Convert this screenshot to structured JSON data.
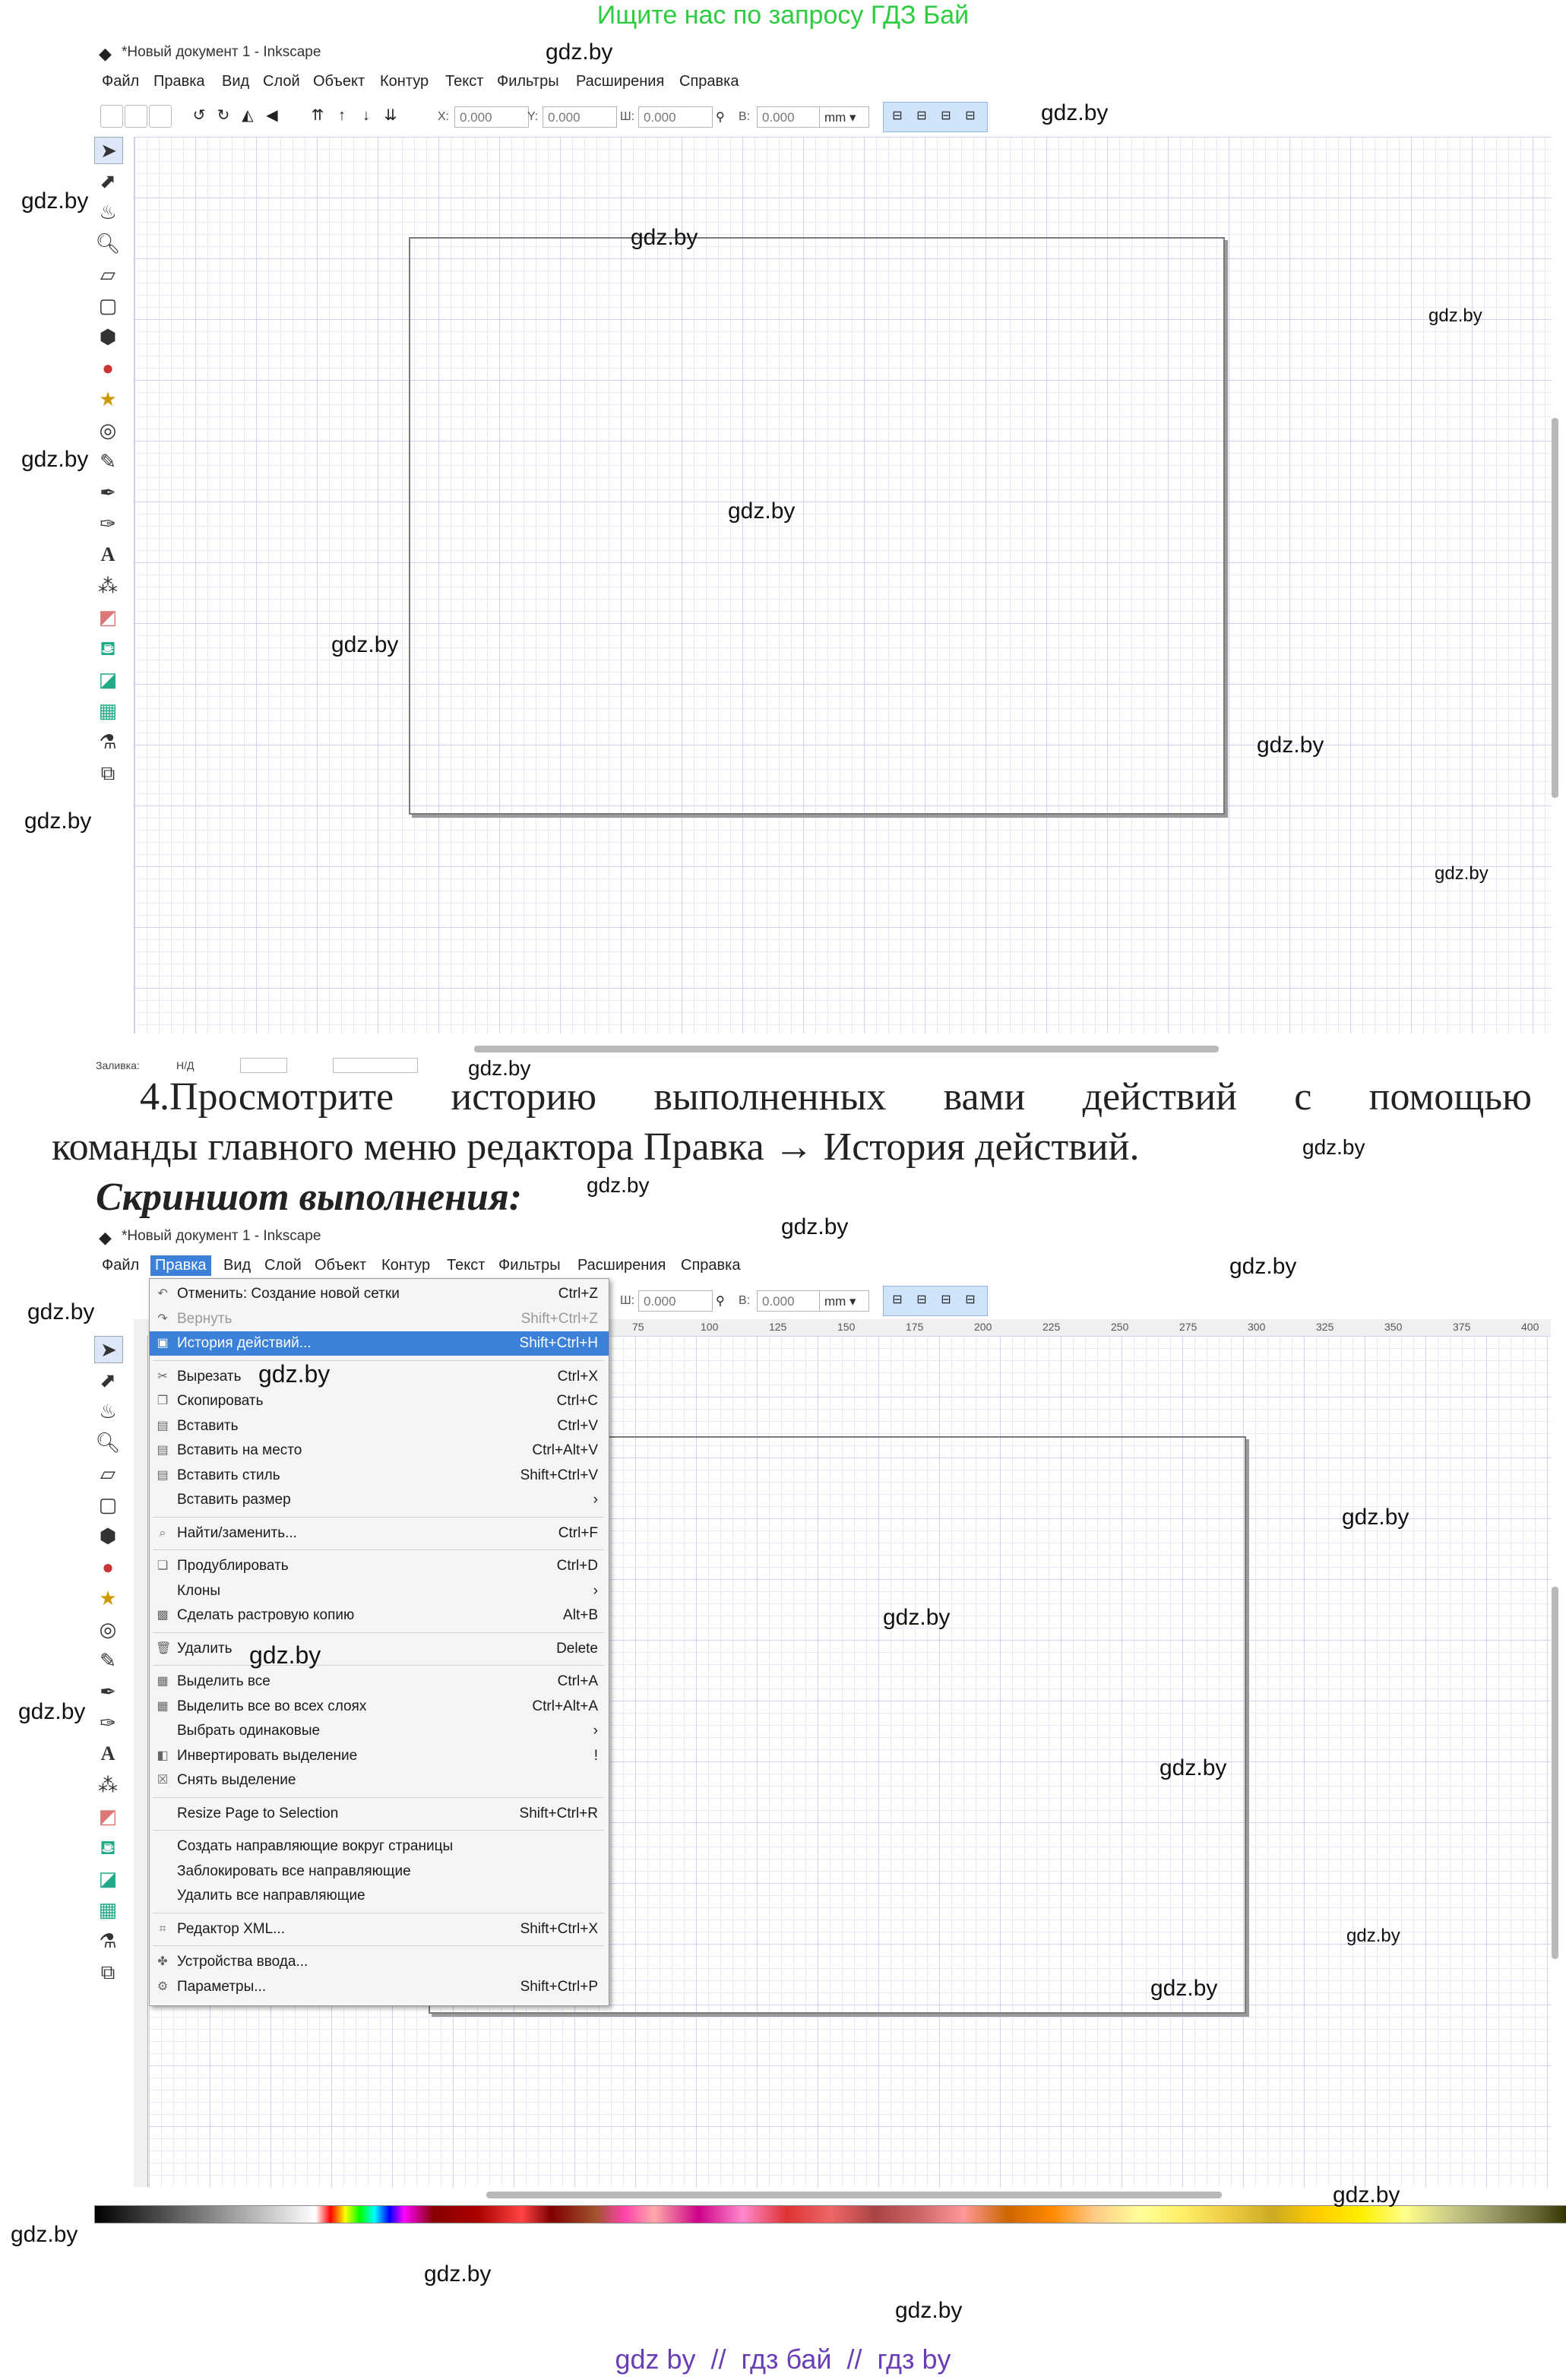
{
  "top_notice": "Ищите нас по запросу ГДЗ Бай",
  "watermark": "gdz.by",
  "window1": {
    "title": "*Новый документ 1 - Inkscape",
    "menu": [
      "Файл",
      "Правка",
      "Вид",
      "Слой",
      "Объект",
      "Контур",
      "Текст",
      "Фильтры",
      "Расширения",
      "Справка"
    ],
    "fields": {
      "x_label": "X:",
      "x_value": "0.000",
      "y_label": "Y:",
      "y_value": "0.000",
      "w_label": "Ш:",
      "w_value": "0.000",
      "h_label": "В:",
      "h_value": "0.000",
      "unit": "mm"
    },
    "status": {
      "zoom_label": "Заливка:",
      "zoom_value": "Н/Д"
    }
  },
  "task": {
    "number": "4.",
    "line1": "Просмотрите историю выполненных вами действий с помощью",
    "line2": "команды главного меню редактора Правка → История действий.",
    "caption": "Скриншот выполнения:"
  },
  "window2": {
    "title": "*Новый документ 1 - Inkscape",
    "menu": [
      "Файл",
      "Правка",
      "Вид",
      "Слой",
      "Объект",
      "Контур",
      "Текст",
      "Фильтры",
      "Расширения",
      "Справка"
    ],
    "active_menu": "Правка",
    "fields": {
      "w_label": "Ш:",
      "w_value": "0.000",
      "h_label": "В:",
      "h_value": "0.000",
      "unit": "mm"
    },
    "ruler": [
      "75",
      "100",
      "125",
      "150",
      "175",
      "200",
      "225",
      "250",
      "275",
      "300",
      "325",
      "350",
      "375",
      "400"
    ],
    "edit_menu": [
      {
        "label": "Отменить: Создание новой сетки",
        "shortcut": "Ctrl+Z",
        "icon": "undo-icon",
        "state": "normal"
      },
      {
        "label": "Вернуть",
        "shortcut": "Shift+Ctrl+Z",
        "icon": "redo-icon",
        "state": "disabled"
      },
      {
        "label": "История действий...",
        "shortcut": "Shift+Ctrl+H",
        "icon": "history-icon",
        "state": "highlighted"
      },
      {
        "sep": true
      },
      {
        "label": "Вырезать",
        "shortcut": "Ctrl+X",
        "icon": "cut-icon",
        "state": "normal"
      },
      {
        "label": "Скопировать",
        "shortcut": "Ctrl+C",
        "icon": "copy-icon",
        "state": "normal"
      },
      {
        "label": "Вставить",
        "shortcut": "Ctrl+V",
        "icon": "paste-icon",
        "state": "normal"
      },
      {
        "label": "Вставить на место",
        "shortcut": "Ctrl+Alt+V",
        "icon": "paste-in-place-icon",
        "state": "normal"
      },
      {
        "label": "Вставить стиль",
        "shortcut": "Shift+Ctrl+V",
        "icon": "paste-style-icon",
        "state": "normal"
      },
      {
        "label": "Вставить размер",
        "shortcut": "›",
        "icon": "",
        "state": "normal"
      },
      {
        "sep": true
      },
      {
        "label": "Найти/заменить...",
        "shortcut": "Ctrl+F",
        "icon": "find-icon",
        "state": "normal"
      },
      {
        "sep": true
      },
      {
        "label": "Продублировать",
        "shortcut": "Ctrl+D",
        "icon": "duplicate-icon",
        "state": "normal"
      },
      {
        "label": "Клоны",
        "shortcut": "›",
        "icon": "",
        "state": "normal"
      },
      {
        "label": "Сделать растровую копию",
        "shortcut": "Alt+B",
        "icon": "bitmap-copy-icon",
        "state": "normal"
      },
      {
        "sep": true
      },
      {
        "label": "Удалить",
        "shortcut": "Delete",
        "icon": "delete-icon",
        "state": "normal"
      },
      {
        "sep": true
      },
      {
        "label": "Выделить все",
        "shortcut": "Ctrl+A",
        "icon": "select-all-icon",
        "state": "normal"
      },
      {
        "label": "Выделить все во всех слоях",
        "shortcut": "Ctrl+Alt+A",
        "icon": "select-all-layers-icon",
        "state": "normal"
      },
      {
        "label": "Выбрать одинаковые",
        "shortcut": "›",
        "icon": "",
        "state": "normal"
      },
      {
        "label": "Инвертировать выделение",
        "shortcut": "!",
        "icon": "invert-selection-icon",
        "state": "normal"
      },
      {
        "label": "Снять выделение",
        "shortcut": "",
        "icon": "deselect-icon",
        "state": "normal"
      },
      {
        "sep": true
      },
      {
        "label": "Resize Page to Selection",
        "shortcut": "Shift+Ctrl+R",
        "icon": "",
        "state": "normal"
      },
      {
        "sep": true
      },
      {
        "label": "Создать направляющие вокруг страницы",
        "shortcut": "",
        "icon": "",
        "state": "normal"
      },
      {
        "label": "Заблокировать все направляющие",
        "shortcut": "",
        "icon": "",
        "state": "normal"
      },
      {
        "label": "Удалить все направляющие",
        "shortcut": "",
        "icon": "",
        "state": "normal"
      },
      {
        "sep": true
      },
      {
        "label": "Редактор XML...",
        "shortcut": "Shift+Ctrl+X",
        "icon": "xml-editor-icon",
        "state": "normal"
      },
      {
        "sep": true
      },
      {
        "label": "Устройства ввода...",
        "shortcut": "",
        "icon": "input-devices-icon",
        "state": "normal"
      },
      {
        "label": "Параметры...",
        "shortcut": "Shift+Ctrl+P",
        "icon": "preferences-icon",
        "state": "normal"
      }
    ]
  },
  "footer": "gdz by  //  гдз бай  //  гдз by",
  "colors": {
    "notice_green": "#2ecc40",
    "footer_purple": "#6a3fb5",
    "highlight": "#3b80d9"
  }
}
